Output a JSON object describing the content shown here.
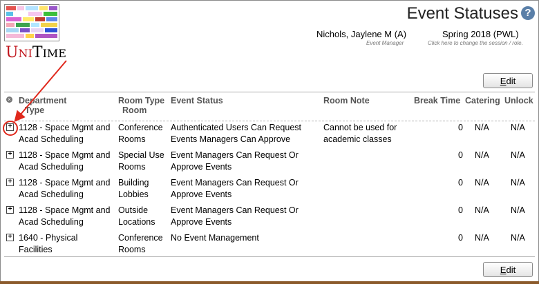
{
  "header": {
    "title": "Event Statuses",
    "user": {
      "name": "Nichols, Jaylene M (A)",
      "role": "Event Manager"
    },
    "session": {
      "name": "Spring 2018 (PWL)",
      "hint": "Click here to change the session / role."
    }
  },
  "logo": {
    "text": [
      "U",
      "NI",
      "T",
      "IME"
    ]
  },
  "buttons": {
    "edit_hotkey": "E",
    "edit_rest": "dit"
  },
  "table": {
    "columns": {
      "department": "Department",
      "type": "Type",
      "room_type": "Room Type",
      "room": "Room",
      "event_status": "Event Status",
      "room_note": "Room Note",
      "break_time": "Break Time",
      "catering": "Catering",
      "unlock": "Unlock"
    },
    "rows": [
      {
        "department_l1": "1128 - Space Mgmt and",
        "department_l2": "Acad Scheduling",
        "room_type_l1": "Conference",
        "room_type_l2": "Rooms",
        "status_l1": "Authenticated Users Can Request",
        "status_l2": "Events Managers Can Approve",
        "note_l1": "Cannot be used for",
        "note_l2": "academic classes",
        "break_time": "0",
        "catering": "N/A",
        "unlock": "N/A"
      },
      {
        "department_l1": "1128 - Space Mgmt and",
        "department_l2": "Acad Scheduling",
        "room_type_l1": "Special Use",
        "room_type_l2": "Rooms",
        "status_l1": "Event Managers Can Request Or",
        "status_l2": "Approve Events",
        "note_l1": "",
        "note_l2": "",
        "break_time": "0",
        "catering": "N/A",
        "unlock": "N/A"
      },
      {
        "department_l1": "1128 - Space Mgmt and",
        "department_l2": "Acad Scheduling",
        "room_type_l1": "Building",
        "room_type_l2": "Lobbies",
        "status_l1": "Event Managers Can Request Or",
        "status_l2": "Approve Events",
        "note_l1": "",
        "note_l2": "",
        "break_time": "0",
        "catering": "N/A",
        "unlock": "N/A"
      },
      {
        "department_l1": "1128 - Space Mgmt and",
        "department_l2": "Acad Scheduling",
        "room_type_l1": "Outside",
        "room_type_l2": "Locations",
        "status_l1": "Event Managers Can Request Or",
        "status_l2": "Approve Events",
        "note_l1": "",
        "note_l2": "",
        "break_time": "0",
        "catering": "N/A",
        "unlock": "N/A"
      },
      {
        "department_l1": "1640 - Physical",
        "department_l2": "Facilities",
        "room_type_l1": "Conference",
        "room_type_l2": "Rooms",
        "status_l1": "No Event Management",
        "status_l2": "",
        "note_l1": "",
        "note_l2": "",
        "break_time": "0",
        "catering": "N/A",
        "unlock": "N/A"
      }
    ]
  },
  "colors": {
    "annotation": "#e0281c",
    "help_icon": "#5a7fa8",
    "footer_bar": "#8b5a2b"
  }
}
